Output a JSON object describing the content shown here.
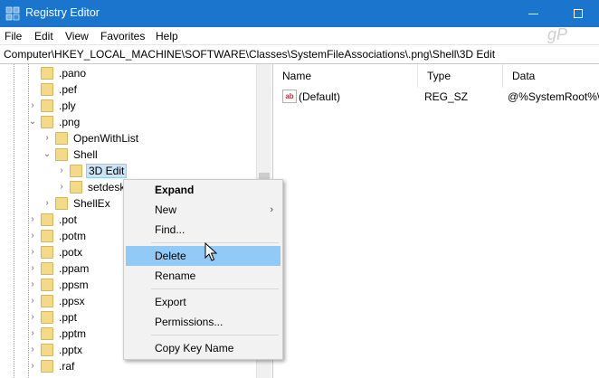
{
  "window": {
    "title": "Registry Editor"
  },
  "menubar": {
    "items": [
      "File",
      "Edit",
      "View",
      "Favorites",
      "Help"
    ]
  },
  "addressbar": {
    "path": "Computer\\HKEY_LOCAL_MACHINE\\SOFTWARE\\Classes\\SystemFileAssociations\\.png\\Shell\\3D Edit"
  },
  "tree": {
    "items": [
      {
        "label": ".pano",
        "expander": ""
      },
      {
        "label": ".pef",
        "expander": ""
      },
      {
        "label": ".ply",
        "expander": "›"
      },
      {
        "label": ".png",
        "expander": "⌄"
      },
      {
        "label": "OpenWithList",
        "expander": "›"
      },
      {
        "label": "Shell",
        "expander": "⌄"
      },
      {
        "label": "3D Edit",
        "expander": "›"
      },
      {
        "label": "setdesk",
        "expander": "›"
      },
      {
        "label": "ShellEx",
        "expander": "›"
      },
      {
        "label": ".pot",
        "expander": "›"
      },
      {
        "label": ".potm",
        "expander": "›"
      },
      {
        "label": ".potx",
        "expander": "›"
      },
      {
        "label": ".ppam",
        "expander": "›"
      },
      {
        "label": ".ppsm",
        "expander": "›"
      },
      {
        "label": ".ppsx",
        "expander": "›"
      },
      {
        "label": ".ppt",
        "expander": "›"
      },
      {
        "label": ".pptm",
        "expander": "›"
      },
      {
        "label": ".pptx",
        "expander": "›"
      },
      {
        "label": ".raf",
        "expander": "›"
      }
    ]
  },
  "list": {
    "columns": [
      "Name",
      "Type",
      "Data"
    ],
    "rows": [
      {
        "name": "(Default)",
        "type": "REG_SZ",
        "data": "@%SystemRoot%\\"
      }
    ]
  },
  "context_menu": {
    "items": [
      {
        "label": "Expand"
      },
      {
        "label": "New",
        "arrow": "›"
      },
      {
        "label": "Find..."
      },
      {
        "label": "Delete"
      },
      {
        "label": "Rename"
      },
      {
        "label": "Export"
      },
      {
        "label": "Permissions..."
      },
      {
        "label": "Copy Key Name"
      }
    ]
  },
  "colors": {
    "titlebar": "#1c75cc",
    "highlight": "#91c9f7",
    "folder": "#f3d98a",
    "selection": "#cce4f7"
  },
  "icons": {
    "app": "registry-icon",
    "value": "string-value-icon",
    "folder": "folder-icon"
  }
}
